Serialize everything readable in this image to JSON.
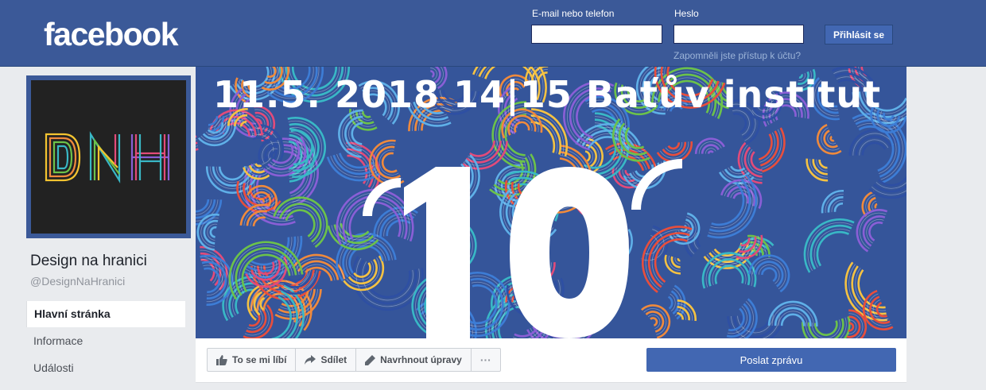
{
  "header": {
    "logo": "facebook",
    "email_label": "E-mail nebo telefon",
    "password_label": "Heslo",
    "login_button": "Přihlásit se",
    "forgot_link": "Zapomněli jste přístup k účtu?"
  },
  "profile": {
    "picture_text": "DNH",
    "name": "Design na hranici",
    "handle": "@DesignNaHranici"
  },
  "nav": {
    "items": [
      {
        "label": "Hlavní stránka",
        "active": true
      },
      {
        "label": "Informace",
        "active": false
      },
      {
        "label": "Události",
        "active": false
      }
    ]
  },
  "cover": {
    "headline": "11.5. 2018   14|15 Baťův institut",
    "big_number": "10"
  },
  "actions": {
    "like": "To se mi líbí",
    "share": "Sdílet",
    "suggest": "Navrhnout úpravy",
    "more": "···",
    "send_message": "Poslat zprávu"
  },
  "colors": {
    "brand": "#3b5998",
    "button": "#4267b2",
    "page_bg": "#e9ebee"
  }
}
